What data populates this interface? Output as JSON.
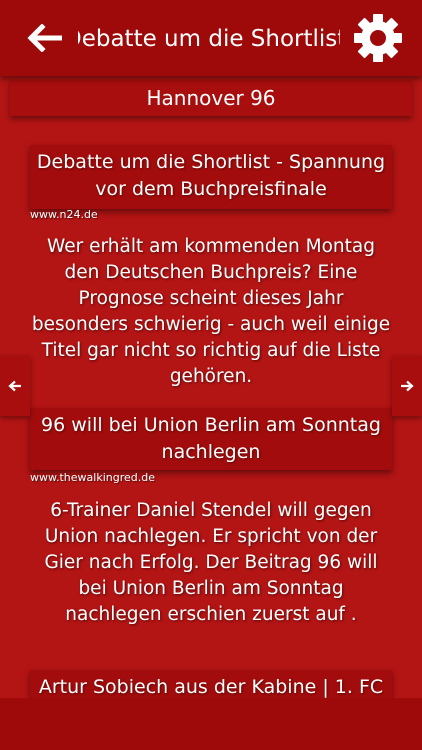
{
  "header": {
    "title": "Debatte um die Shortlist - Spannung vor dem Buchpreisfinale",
    "back_icon": "arrow-left-icon",
    "settings_icon": "gear-icon"
  },
  "team": {
    "name": "Hannover 96"
  },
  "articles": [
    {
      "headline": "Debatte um die Shortlist - Spannung vor dem Buchpreisfinale",
      "source": "www.n24.de",
      "summary": "Wer erhält am kommenden Montag den Deutschen Buchpreis? Eine Prognose scheint dieses Jahr besonders schwierig - auch weil einige Titel gar nicht so richtig auf die Liste gehören."
    },
    {
      "headline": "96 will bei Union Berlin am Sonntag nachlegen",
      "source": "www.thewalkingred.de",
      "summary": "6-Trainer Daniel Stendel will gegen Union nachlegen. Er spricht von der Gier nach Erfolg. Der Beitrag 96 will bei Union Berlin am Sonntag nachlegen erschien zuerst auf ."
    },
    {
      "headline": "Artur Sobiech aus der Kabine | 1. FC"
    }
  ],
  "nav": {
    "prev_icon": "arrow-left-small-icon",
    "next_icon": "arrow-right-small-icon"
  },
  "colors": {
    "background": "#b31414",
    "bar": "#9e0a0a",
    "text": "#ffffff"
  }
}
